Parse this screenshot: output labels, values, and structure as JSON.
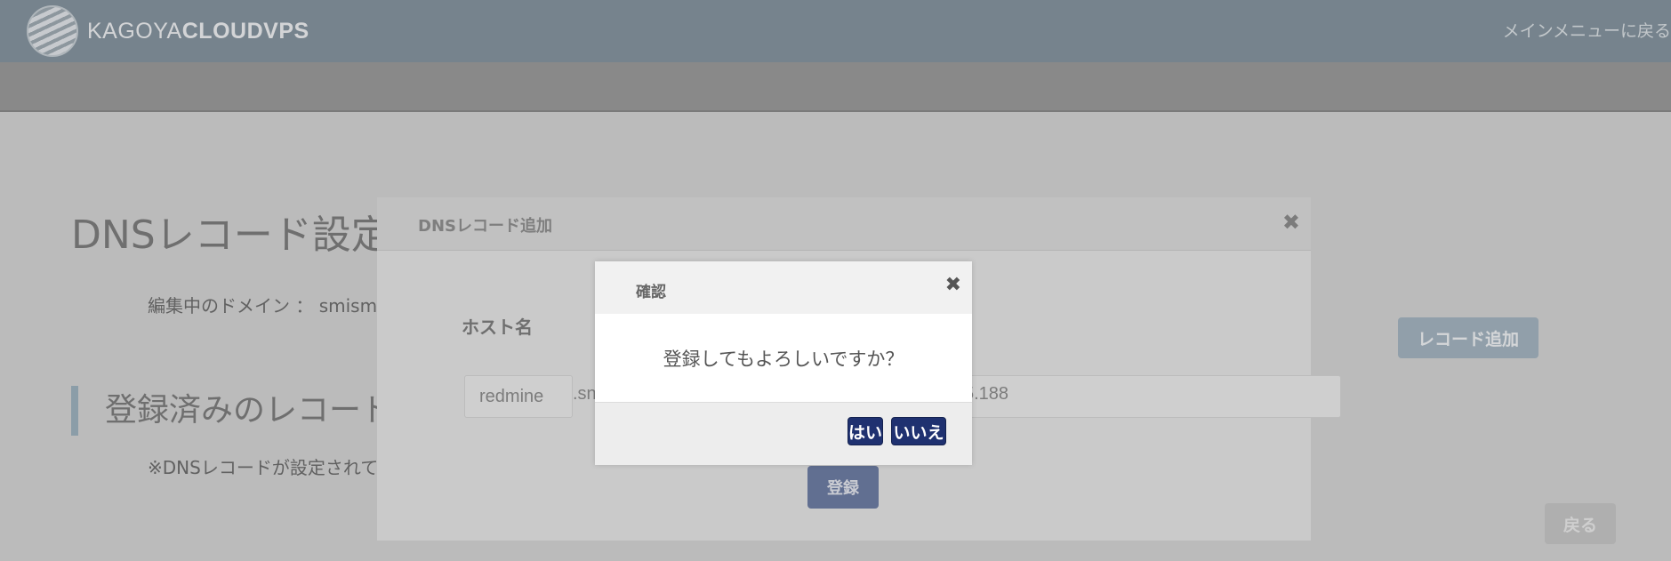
{
  "header": {
    "logo_text_light": "KAGOYA",
    "logo_text_bold": "CLOUD",
    "logo_text_tail": "VPS",
    "back_to_menu": "メインメニューに戻る"
  },
  "page": {
    "title": "DNSレコード設定",
    "domain_line": "編集中のドメイン ： smism",
    "section_title": "登録済みのレコード",
    "note": "※DNSレコードが設定されて",
    "add_record_button": "レコード追加",
    "back_button": "戻る"
  },
  "dns_modal": {
    "title": "DNSレコード追加",
    "close_glyph": "✖",
    "hostname_label": "ホスト名",
    "host_value": "redmine",
    "domain_suffix": ".sn",
    "value_fragment": "5.188",
    "register_button": "登録"
  },
  "confirm": {
    "title": "確認",
    "close_glyph": "✖",
    "message": "登録してもよろしいですか？",
    "yes": "はい",
    "no": "いいえ"
  },
  "colors": {
    "header_bg": "#83939f",
    "confirm_button": "#1f3170",
    "register_button": "#6a7aa4",
    "add_record_button": "#a4b5c2"
  }
}
